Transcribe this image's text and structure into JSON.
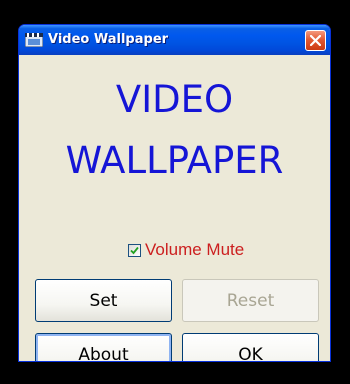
{
  "window": {
    "title": "Video Wallpaper",
    "app_icon": "film-clapper-icon",
    "close_icon": "close-icon"
  },
  "headline": {
    "line1": "VIDEO",
    "line2": "WALLPAPER"
  },
  "volume_mute": {
    "label": "Volume Mute",
    "checked": true
  },
  "buttons": {
    "set": "Set",
    "reset": "Reset",
    "about": "About",
    "ok": "OK"
  },
  "colors": {
    "headline": "#1515d6",
    "mute_label": "#cc1f1f",
    "window_face": "#ece9d8",
    "titlebar": "#0054e3"
  }
}
